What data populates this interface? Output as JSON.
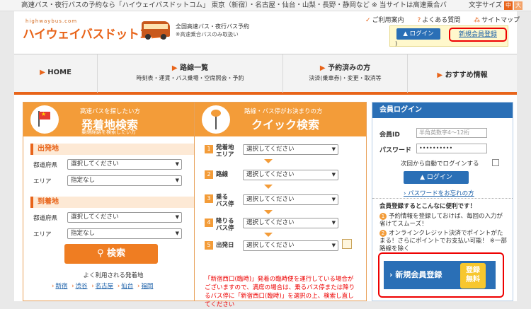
{
  "topbar": {
    "message": "高速バス・夜行バスの予約なら「ハイウェイバスドットコム」 東京（新宿）・名古屋・仙台・山梨・長野・静岡など ※ 当サイトは高速乗合バ",
    "font_size_label": "文字サイズ",
    "font_mid": "中",
    "font_large": "大"
  },
  "header": {
    "logo_small": "highwaybus.com",
    "logo": "ハイウェイバスドットコム",
    "tagline1": "全国高速バス・夜行バス予約",
    "tagline2": "※高速乗合バスのみ取扱い",
    "links": [
      "ご利用案内",
      "よくある質問",
      "サイトマップ"
    ],
    "login": "ログイン",
    "register": "新規会員登録",
    "paren": ")"
  },
  "nav": [
    {
      "title": "HOME",
      "sub": ""
    },
    {
      "title": "路線一覧",
      "sub": "時刻表・運賃・バス乗場・空席照会・予約"
    },
    {
      "title": "予約済みの方",
      "sub": "決済(乗車券)・変更・取消等"
    },
    {
      "title": "おすすめ情報",
      "sub": ""
    }
  ],
  "departure": {
    "sub": "高速バスを探したい方",
    "title": "発着地検索",
    "sub2": "乗継経路を検索したい方",
    "from_title": "出発地",
    "to_title": "到着地",
    "pref_label": "都道府県",
    "area_label": "エリア",
    "select_placeholder": "選択してください",
    "area_none": "指定なし",
    "search_btn": "検索",
    "popular_title": "よく利用される発着地",
    "popular": [
      "新宿",
      "渋谷",
      "名古屋",
      "仙台",
      "福岡"
    ]
  },
  "quick": {
    "sub": "路線・バス停がお決まりの方",
    "title": "クイック検索",
    "steps": [
      {
        "num": "1",
        "label": "発着地\nエリア"
      },
      {
        "num": "2",
        "label": "路線"
      },
      {
        "num": "3",
        "label": "乗る\nバス停"
      },
      {
        "num": "4",
        "label": "降りる\nバス停"
      },
      {
        "num": "5",
        "label": "出発日"
      }
    ],
    "select_placeholder": "選択してください",
    "notice": "「新宿西口(臨時)」発着の臨時便を運行している場合がございますので、満席の場合は、乗るバス停または降りるバス停に「新宿西口(臨時)」を選択の上、検索し直してください"
  },
  "member": {
    "title": "会員ログイン",
    "id_label": "会員ID",
    "id_placeholder": "半角英数字4〜12桁",
    "pw_label": "パスワード",
    "pw_value": "••••••••••",
    "auto_login": "次回から自動でログインする",
    "login_btn": "ログイン",
    "forgot": "パスワードをお忘れの方",
    "benefit_title": "会員登録するとこんなに便利です！",
    "benefit1": "予約情報を登録しておけば、毎回の入力が省けてスムーズ！",
    "benefit2": "オンラインクレジット決済でポイントがたまる！さらにポイントでお支払い可能！ ※一部路線を除く",
    "register_btn": "新規会員登録",
    "badge": "登録\n無料"
  },
  "colors": {
    "accent": "#e8641a",
    "blue": "#2a6fb6",
    "red": "#ee0000"
  }
}
